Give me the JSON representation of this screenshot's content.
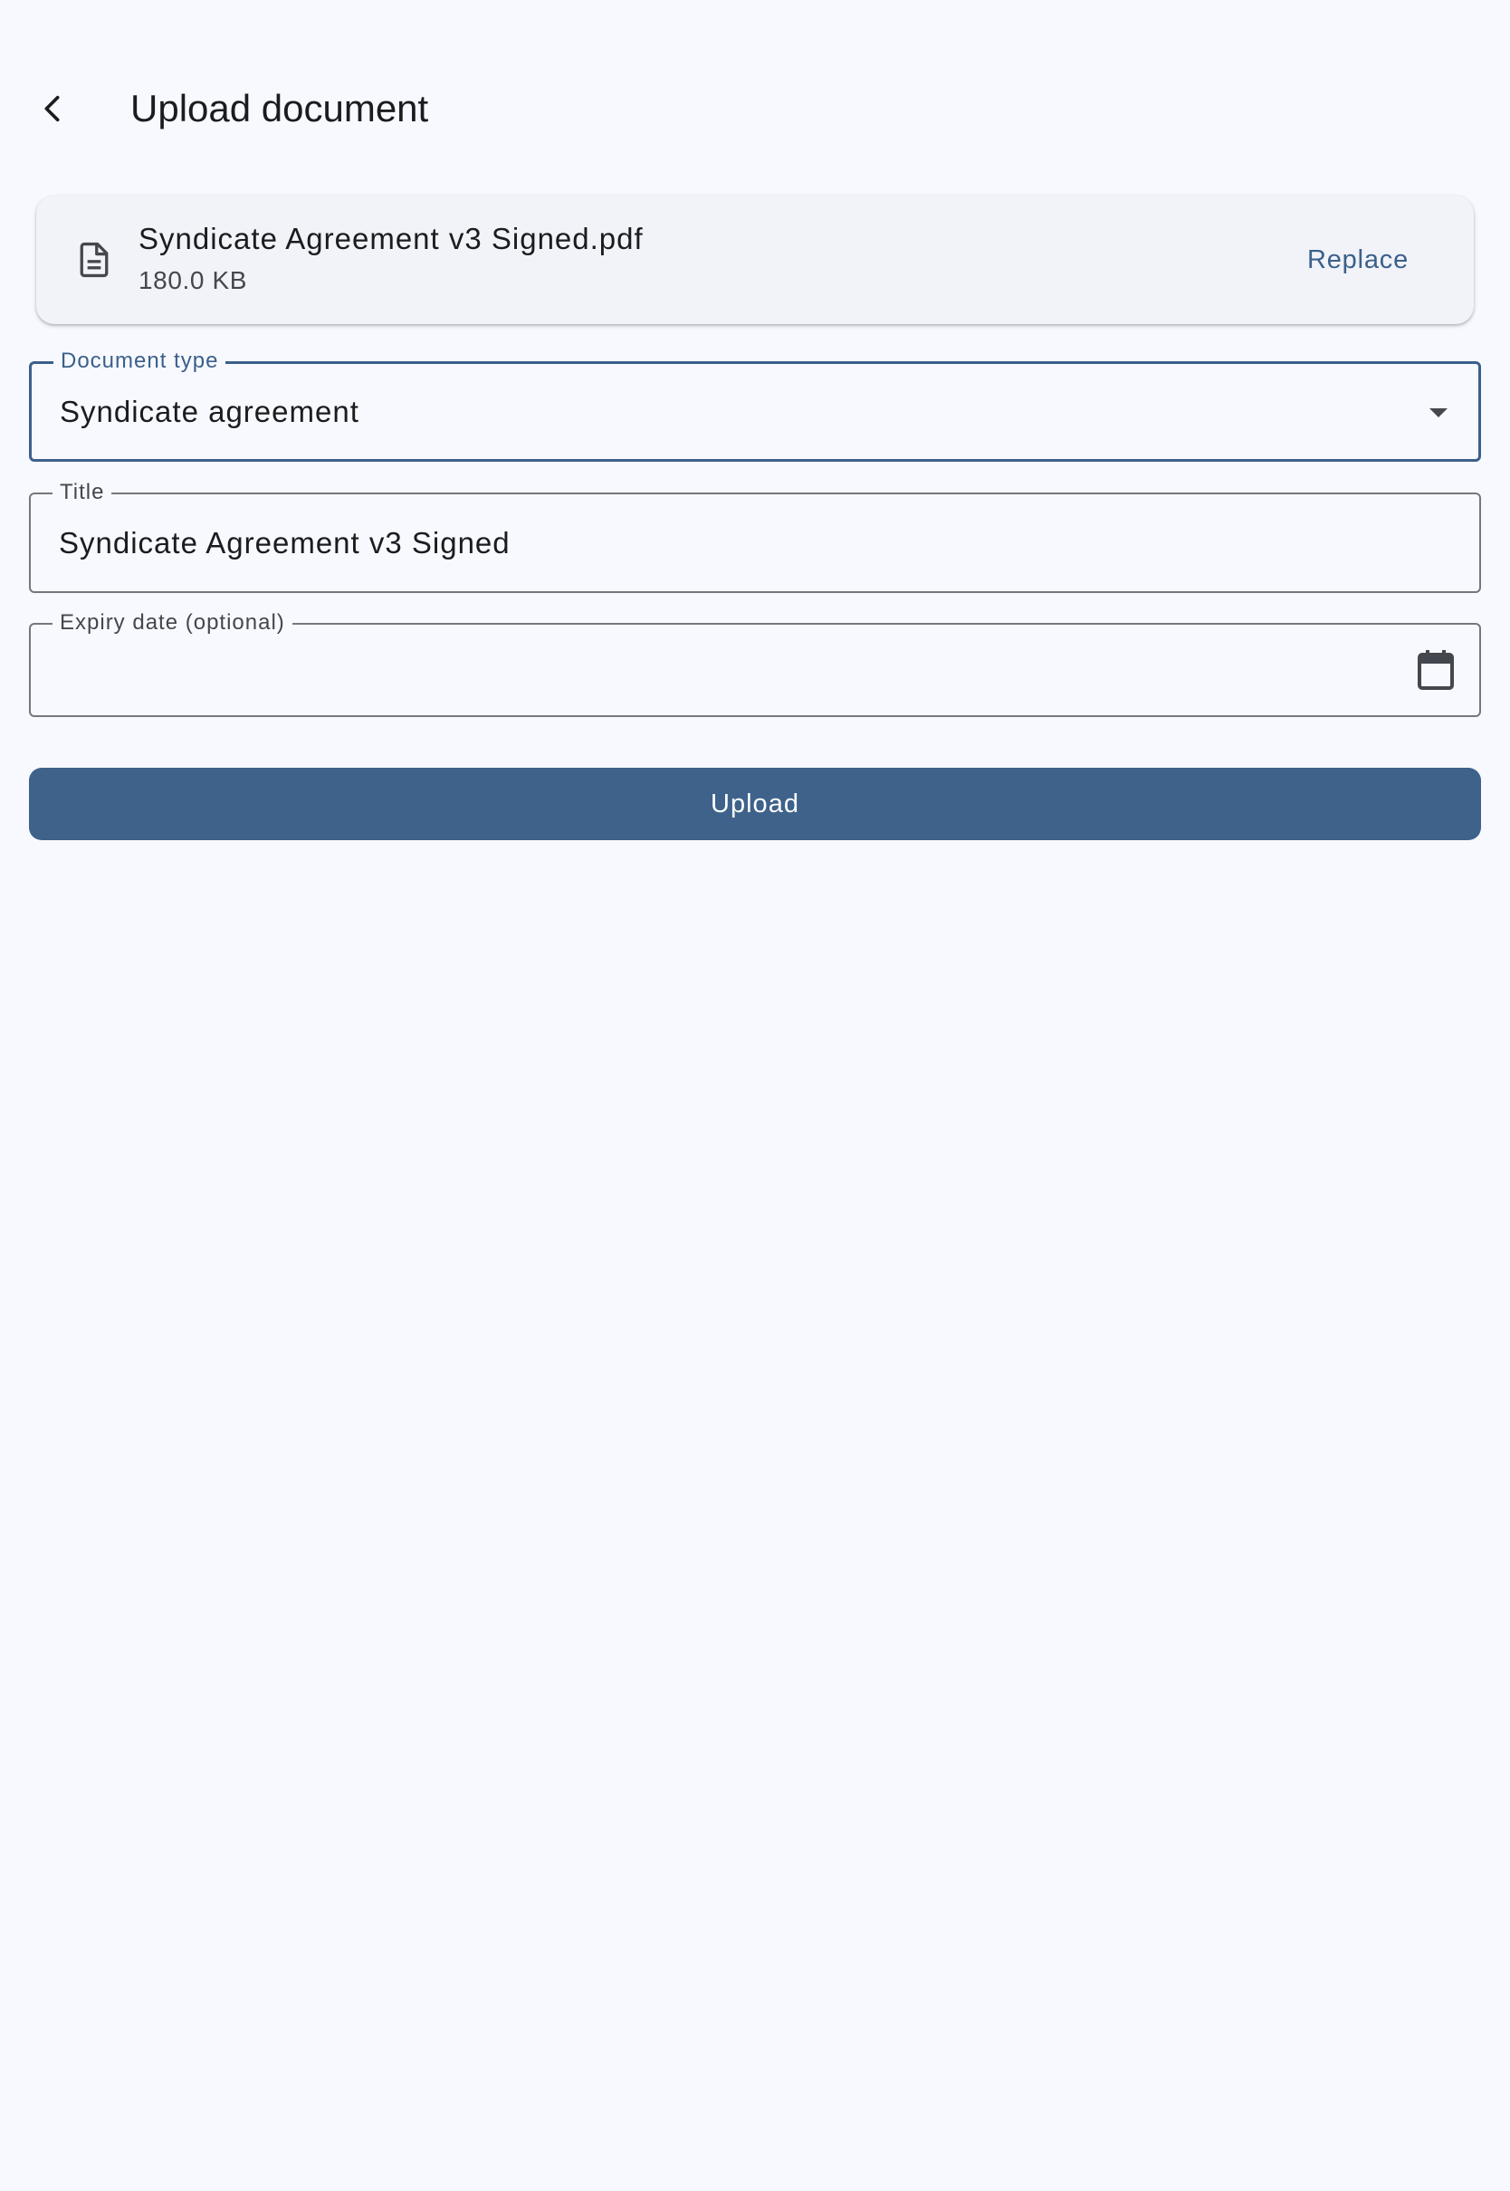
{
  "header": {
    "title": "Upload document",
    "back_icon": "chevron-left-icon"
  },
  "file": {
    "icon": "document-icon",
    "name": "Syndicate Agreement v3 Signed.pdf",
    "size": "180.0 KB",
    "replace_label": "Replace"
  },
  "form": {
    "document_type": {
      "label": "Document type",
      "value": "Syndicate agreement",
      "icon": "dropdown-arrow-icon"
    },
    "title": {
      "label": "Title",
      "value": "Syndicate Agreement v3 Signed"
    },
    "expiry_date": {
      "label": "Expiry date (optional)",
      "value": "",
      "icon": "calendar-icon"
    }
  },
  "actions": {
    "upload_label": "Upload"
  },
  "colors": {
    "background": "#f7f9fe",
    "primary": "#3e628a",
    "accent_text": "#3b608b",
    "card": "#f1f3f8",
    "outline": "#74777f"
  }
}
